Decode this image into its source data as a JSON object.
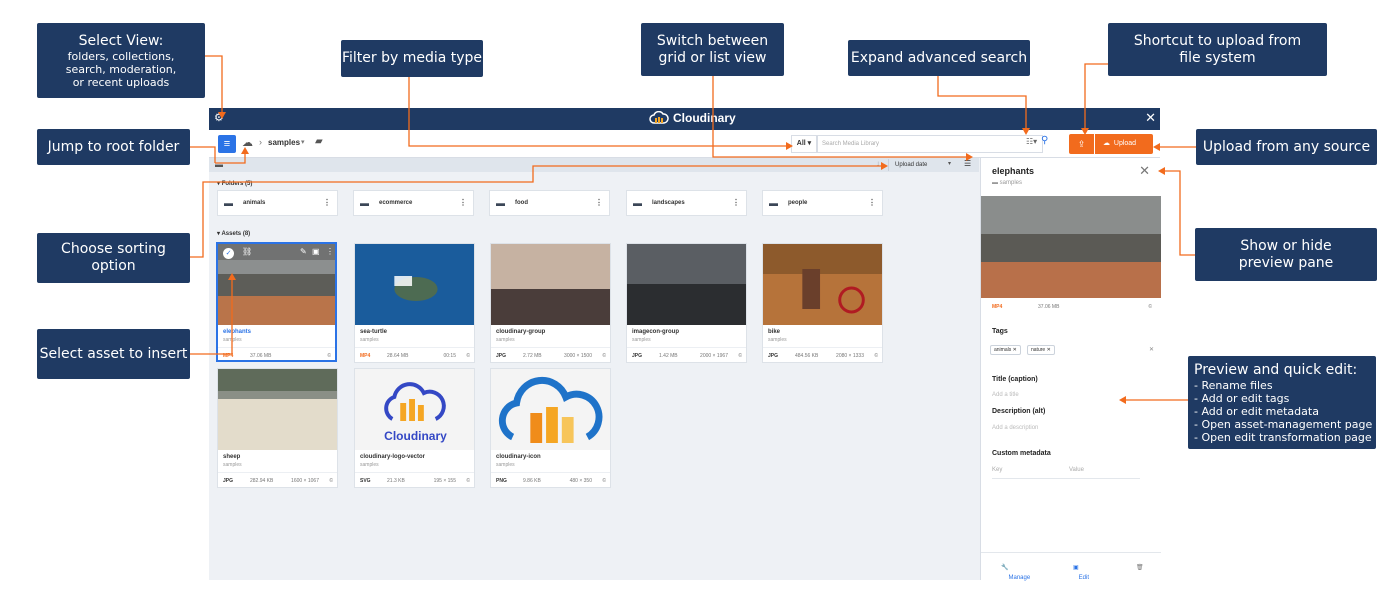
{
  "colors": {
    "callout_bg": "#1f3a63",
    "accent_orange": "#f26b1d",
    "accent_blue": "#2b73e6"
  },
  "callouts": {
    "select_view_title": "Select View:",
    "select_view_lines": [
      "folders, collections,",
      "search,  moderation,",
      "or recent uploads"
    ],
    "filter": "Filter by media type",
    "switch_view": "Switch between grid or list view",
    "advanced_search": "Expand advanced search",
    "shortcut_upload": "Shortcut to upload from file system",
    "jump_root": "Jump to root folder",
    "upload_any": "Upload from any source",
    "sorting": "Choose sorting option",
    "preview_pane": "Show or hide  preview pane",
    "select_asset": "Select asset to insert",
    "quick_edit_title": "Preview and quick edit:",
    "quick_edit_lines": [
      "- Rename files",
      "- Add or edit tags",
      "- Add or edit metadata",
      "- Open asset-management page",
      "- Open edit transformation page"
    ]
  },
  "app": {
    "title": "Cloudinary",
    "breadcrumb": "samples",
    "filter_label": "All",
    "search_placeholder": "Search Media Library",
    "upload_label": "Upload",
    "sort_label": "Upload date",
    "folders_header": "Folders (5)",
    "assets_header": "Assets (8)",
    "icons": [
      "gear-icon",
      "close-icon",
      "list-view-icon",
      "cloud-icon",
      "chevron-right-icon",
      "chevron-down-icon",
      "folder-plus-icon",
      "filter-icon",
      "search-icon",
      "upload-icon",
      "folder-icon",
      "more-icon",
      "copy-icon",
      "wrench-icon",
      "crop-icon",
      "trash-icon",
      "check-icon",
      "link-icon"
    ]
  },
  "folders": [
    "animals",
    "ecommerce",
    "food",
    "landscapes",
    "people"
  ],
  "assets": [
    {
      "name": "elephants",
      "folder": "samples",
      "format": "MP4",
      "size": "37.06 MB",
      "dims": ""
    },
    {
      "name": "sea-turtle",
      "folder": "samples",
      "format": "MP4",
      "size": "28.64 MB",
      "dims": "00:15"
    },
    {
      "name": "cloudinary-group",
      "folder": "samples",
      "format": "JPG",
      "size": "2.72 MB",
      "dims": "3000 × 1500"
    },
    {
      "name": "imagecon-group",
      "folder": "samples",
      "format": "JPG",
      "size": "1.42 MB",
      "dims": "2000 × 1967"
    },
    {
      "name": "bike",
      "folder": "samples",
      "format": "JPG",
      "size": "484.56 KB",
      "dims": "2080 × 1333"
    },
    {
      "name": "sheep",
      "folder": "samples",
      "format": "JPG",
      "size": "282.94 KB",
      "dims": "1600 × 1067"
    },
    {
      "name": "cloudinary-logo-vector",
      "folder": "samples",
      "format": "SVG",
      "size": "21.3 KB",
      "dims": "195 × 155"
    },
    {
      "name": "cloudinary-icon",
      "folder": "samples",
      "format": "PNG",
      "size": "9.86 KB",
      "dims": "480 × 350"
    }
  ],
  "preview": {
    "title": "elephants",
    "folder": "samples",
    "format": "MP4",
    "size": "37.06 MB",
    "tags_label": "Tags",
    "tags": [
      "animals",
      "nature"
    ],
    "title_caption_label": "Title (caption)",
    "title_placeholder": "Add a title",
    "description_label": "Description (alt)",
    "description_placeholder": "Add a description",
    "custom_metadata_label": "Custom metadata",
    "key_label": "Key",
    "value_label": "Value",
    "manage_label": "Manage",
    "edit_label": "Edit"
  },
  "cloudinary_logo_text": "Cloudinary"
}
